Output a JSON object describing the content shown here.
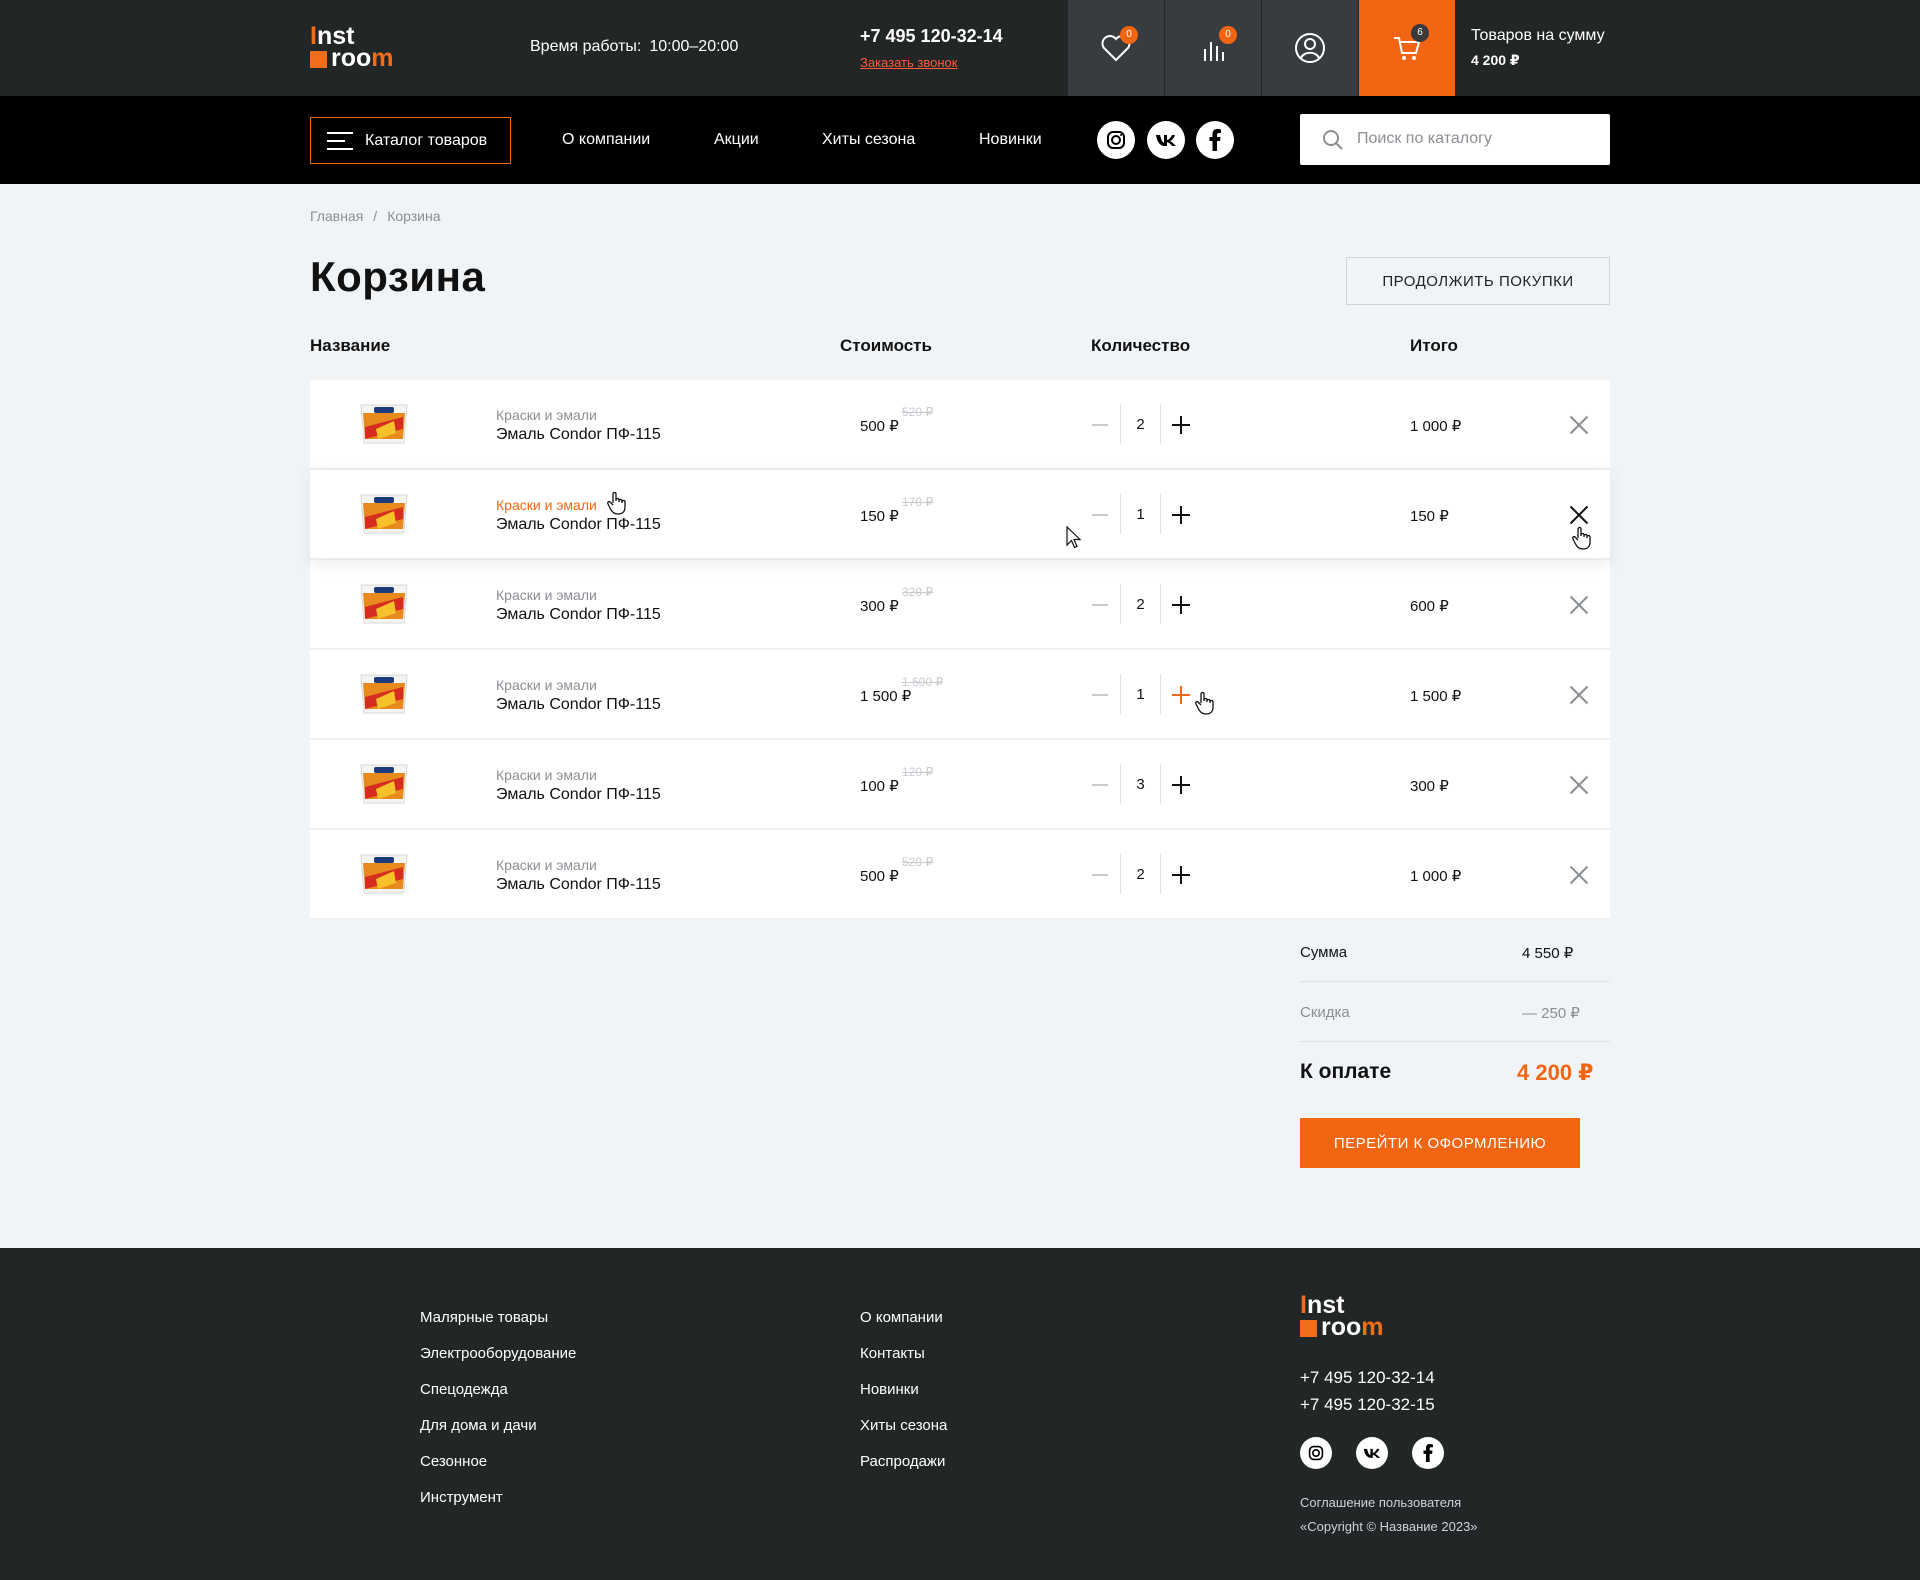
{
  "brand": {
    "line1": "nst",
    "line1_accent": "I",
    "line2": "roo",
    "line2_accent": "m",
    "accent": "#f26512"
  },
  "header": {
    "hours_label": "Время работы:",
    "hours_value": "10:00–20:00",
    "phone": "+7 495 120-32-14",
    "callback": "Заказать звонок",
    "favorites_count": "0",
    "compare_count": "0",
    "cart_count": "6",
    "cart_sum_label": "Товаров на сумму",
    "cart_sum_value": "4 200 ₽",
    "icons": [
      "heart-icon",
      "compare-bars-icon",
      "user-icon",
      "cart-icon"
    ]
  },
  "nav": {
    "catalog": "Каталог товаров",
    "links": [
      "О компании",
      "Акции",
      "Хиты сезона",
      "Новинки"
    ],
    "social": [
      "instagram-icon",
      "vk-icon",
      "facebook-icon"
    ],
    "search_placeholder": "Поиск по каталогу"
  },
  "breadcrumbs": [
    "Главная",
    "Корзина"
  ],
  "page_title": "Корзина",
  "continue_button": "ПРОДОЛЖИТЬ ПОКУПКИ",
  "table": {
    "headers": [
      "Название",
      "Стоимость",
      "Количество",
      "Итого"
    ],
    "rows": [
      {
        "category": "Краски и эмали",
        "name": "Эмаль Condor ПФ-115",
        "price": "500 ₽",
        "old_price": "520 ₽",
        "qty": "2",
        "total": "1 000 ₽"
      },
      {
        "category": "Краски и эмали",
        "name": "Эмаль Condor ПФ-115",
        "price": "150 ₽",
        "old_price": "170 ₽",
        "qty": "1",
        "total": "150 ₽"
      },
      {
        "category": "Краски и эмали",
        "name": "Эмаль Condor ПФ-115",
        "price": "300 ₽",
        "old_price": "320 ₽",
        "qty": "2",
        "total": "600 ₽"
      },
      {
        "category": "Краски и эмали",
        "name": "Эмаль Condor ПФ-115",
        "price": "1 500 ₽",
        "old_price": "1 600 ₽",
        "qty": "1",
        "total": "1 500 ₽"
      },
      {
        "category": "Краски и эмали",
        "name": "Эмаль Condor ПФ-115",
        "price": "100 ₽",
        "old_price": "120 ₽",
        "qty": "3",
        "total": "300 ₽"
      },
      {
        "category": "Краски и эмали",
        "name": "Эмаль Condor ПФ-115",
        "price": "500 ₽",
        "old_price": "520 ₽",
        "qty": "2",
        "total": "1 000 ₽"
      }
    ]
  },
  "summary": {
    "sum_label": "Сумма",
    "sum_value": "4 550 ₽",
    "discount_label": "Скидка",
    "discount_value": "— 250 ₽",
    "pay_label": "К оплате",
    "pay_value": "4 200 ₽",
    "checkout": "ПЕРЕЙТИ К ОФОРМЛЕНИЮ"
  },
  "footer": {
    "col1": [
      "Малярные товары",
      "Электрооборудование",
      "Спецодежда",
      "Для дома и дачи",
      "Сезонное",
      "Инструмент"
    ],
    "col2": [
      "О компании",
      "Контакты",
      "Новинки",
      "Хиты сезона",
      "Распродажи"
    ],
    "phones": [
      "+7 495 120-32-14",
      "+7 495 120-32-15"
    ],
    "agreement": "Соглашение пользователя",
    "copyright": "«Copyright © Название 2023»"
  }
}
